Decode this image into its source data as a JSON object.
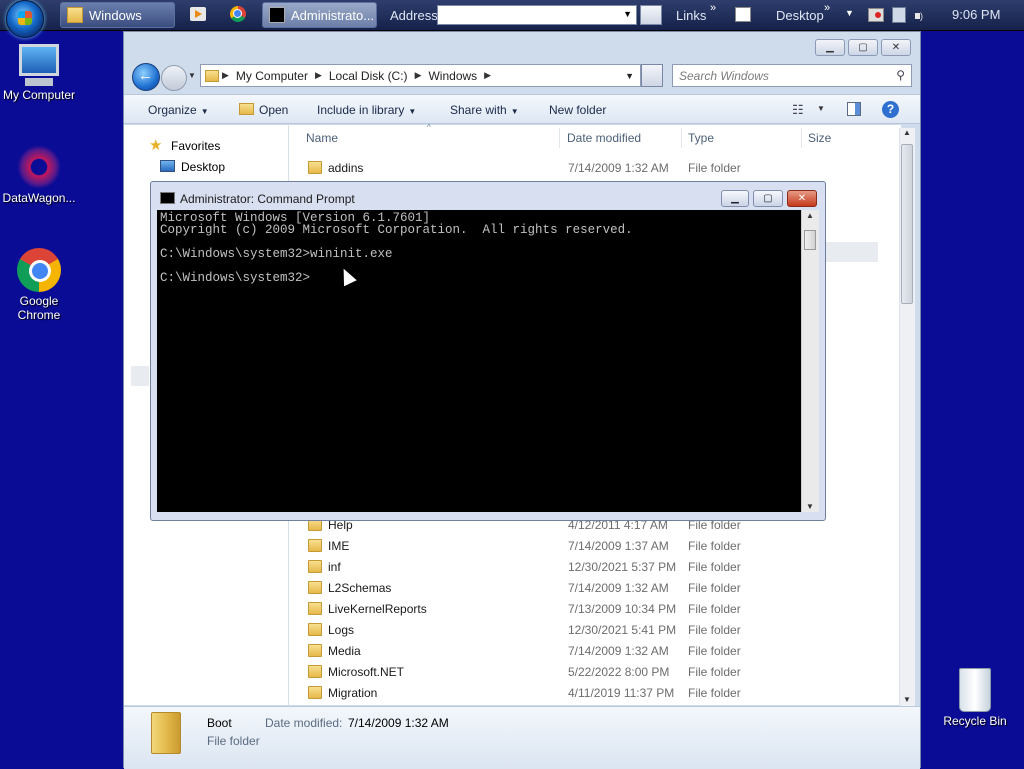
{
  "taskbar": {
    "windows_btn": "Windows",
    "admin_btn": "Administrato...",
    "address_label": "Address",
    "links_label": "Links",
    "desktop_label": "Desktop",
    "clock": "9:06 PM"
  },
  "desktop_icons": [
    {
      "label": "My Computer"
    },
    {
      "label": "DataWagon..."
    },
    {
      "label": "Google Chrome"
    },
    {
      "label": "Recycle Bin"
    }
  ],
  "explorer": {
    "breadcrumb": [
      "My Computer",
      "Local Disk (C:)",
      "Windows"
    ],
    "search_placeholder": "Search Windows",
    "toolbar": {
      "organize": "Organize",
      "open": "Open",
      "include": "Include in library",
      "share": "Share with",
      "new_folder": "New folder"
    },
    "nav": {
      "favorites": "Favorites",
      "desktop": "Desktop"
    },
    "columns": {
      "name": "Name",
      "date": "Date modified",
      "type": "Type",
      "size": "Size"
    },
    "rows_top": [
      {
        "name": "addins",
        "date": "7/14/2009 1:32 AM",
        "type": "File folder"
      }
    ],
    "rows": [
      {
        "name": "Help",
        "date": "4/12/2011 4:17 AM",
        "type": "File folder"
      },
      {
        "name": "IME",
        "date": "7/14/2009 1:37 AM",
        "type": "File folder"
      },
      {
        "name": "inf",
        "date": "12/30/2021 5:37 PM",
        "type": "File folder"
      },
      {
        "name": "L2Schemas",
        "date": "7/14/2009 1:32 AM",
        "type": "File folder"
      },
      {
        "name": "LiveKernelReports",
        "date": "7/13/2009 10:34 PM",
        "type": "File folder"
      },
      {
        "name": "Logs",
        "date": "12/30/2021 5:41 PM",
        "type": "File folder"
      },
      {
        "name": "Media",
        "date": "7/14/2009 1:32 AM",
        "type": "File folder"
      },
      {
        "name": "Microsoft.NET",
        "date": "5/22/2022 8:00 PM",
        "type": "File folder"
      },
      {
        "name": "Migration",
        "date": "4/11/2019 11:37 PM",
        "type": "File folder"
      }
    ],
    "details": {
      "name": "Boot",
      "date_label": "Date modified:",
      "date_value": "7/14/2009 1:32 AM",
      "type": "File folder"
    }
  },
  "cmd": {
    "title": "Administrator: Command Prompt",
    "lines": [
      "Microsoft Windows [Version 6.1.7601]",
      "Copyright (c) 2009 Microsoft Corporation.  All rights reserved.",
      "",
      "C:\\Windows\\system32>wininit.exe",
      "",
      "C:\\Windows\\system32>"
    ]
  }
}
